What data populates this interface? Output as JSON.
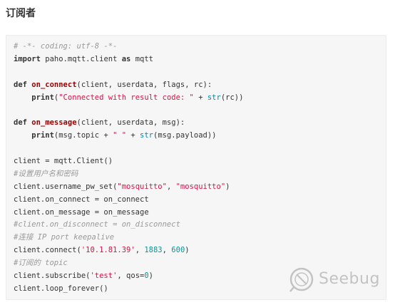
{
  "heading": "订阅者",
  "code_lines": [
    [
      {
        "t": "# -*- coding: utf-8 -*-",
        "c": "cm"
      }
    ],
    [
      {
        "t": "import",
        "c": "kw"
      },
      {
        "t": " paho.mqtt.client ",
        "c": "op"
      },
      {
        "t": "as",
        "c": "kw"
      },
      {
        "t": " mqtt",
        "c": "op"
      }
    ],
    [],
    [
      {
        "t": "def",
        "c": "kw"
      },
      {
        "t": " ",
        "c": "op"
      },
      {
        "t": "on_connect",
        "c": "fn"
      },
      {
        "t": "(client, userdata, flags, rc):",
        "c": "op"
      }
    ],
    [
      {
        "t": "    ",
        "c": "op"
      },
      {
        "t": "print",
        "c": "kw"
      },
      {
        "t": "(",
        "c": "op"
      },
      {
        "t": "\"Connected with result code: \"",
        "c": "st"
      },
      {
        "t": " + ",
        "c": "op"
      },
      {
        "t": "str",
        "c": "bi"
      },
      {
        "t": "(rc))",
        "c": "op"
      }
    ],
    [],
    [
      {
        "t": "def",
        "c": "kw"
      },
      {
        "t": " ",
        "c": "op"
      },
      {
        "t": "on_message",
        "c": "fn"
      },
      {
        "t": "(client, userdata, msg):",
        "c": "op"
      }
    ],
    [
      {
        "t": "    ",
        "c": "op"
      },
      {
        "t": "print",
        "c": "kw"
      },
      {
        "t": "(msg.topic + ",
        "c": "op"
      },
      {
        "t": "\" \"",
        "c": "st"
      },
      {
        "t": " + ",
        "c": "op"
      },
      {
        "t": "str",
        "c": "bi"
      },
      {
        "t": "(msg.payload))",
        "c": "op"
      }
    ],
    [],
    [
      {
        "t": "client = mqtt.Client()",
        "c": "op"
      }
    ],
    [
      {
        "t": "#设置用户名和密码",
        "c": "cm"
      }
    ],
    [
      {
        "t": "client.username_pw_set(",
        "c": "op"
      },
      {
        "t": "\"mosquitto\"",
        "c": "st"
      },
      {
        "t": ", ",
        "c": "op"
      },
      {
        "t": "\"mosquitto\"",
        "c": "st"
      },
      {
        "t": ")",
        "c": "op"
      }
    ],
    [
      {
        "t": "client.on_connect = on_connect",
        "c": "op"
      }
    ],
    [
      {
        "t": "client.on_message = on_message",
        "c": "op"
      }
    ],
    [
      {
        "t": "#client.on_disconnect = on_disconnect",
        "c": "cm"
      }
    ],
    [
      {
        "t": "#连接 IP port keepalive",
        "c": "cm"
      }
    ],
    [
      {
        "t": "client.connect(",
        "c": "op"
      },
      {
        "t": "'10.1.81.39'",
        "c": "st"
      },
      {
        "t": ", ",
        "c": "op"
      },
      {
        "t": "1883",
        "c": "nu"
      },
      {
        "t": ", ",
        "c": "op"
      },
      {
        "t": "600",
        "c": "nu"
      },
      {
        "t": ")",
        "c": "op"
      }
    ],
    [
      {
        "t": "#订阅的 topic",
        "c": "cm"
      }
    ],
    [
      {
        "t": "client.subscribe(",
        "c": "op"
      },
      {
        "t": "'test'",
        "c": "st"
      },
      {
        "t": ", qos=",
        "c": "op"
      },
      {
        "t": "0",
        "c": "nu"
      },
      {
        "t": ")",
        "c": "op"
      }
    ],
    [
      {
        "t": "client.loop_forever()",
        "c": "op"
      }
    ]
  ],
  "watermark": {
    "text": "Seebug",
    "icon": "seebug-logo-icon"
  }
}
